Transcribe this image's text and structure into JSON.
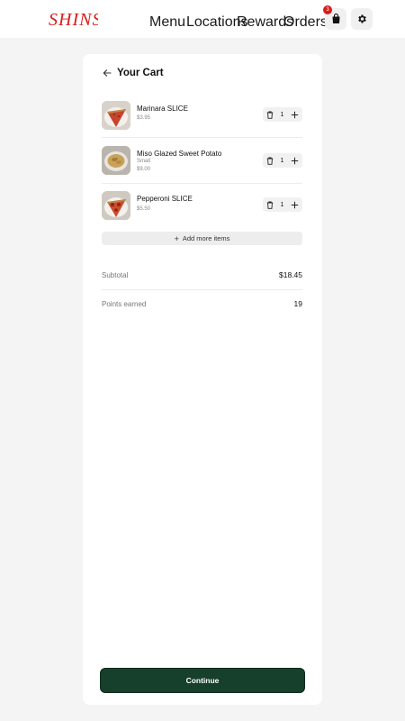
{
  "header": {
    "brand": "SHINS",
    "nav": [
      "Menu",
      "Locations",
      "Rewards",
      "Orders"
    ],
    "cart_badge": "3",
    "cart_icon": "shopping-bag-icon",
    "settings_icon": "gear-icon",
    "brand_color": "#d91a1a"
  },
  "cart": {
    "title": "Your Cart",
    "back_icon": "arrow-left-icon",
    "items": [
      {
        "name": "Marinara SLICE",
        "option": "",
        "price": "$3.95",
        "qty": "1"
      },
      {
        "name": "Miso Glazed Sweet Potato",
        "option": "Small",
        "price": "$9.00",
        "qty": "1"
      },
      {
        "name": "Pepperoni SLICE",
        "option": "",
        "price": "$5.50",
        "qty": "1"
      }
    ],
    "add_more_label": "Add more items",
    "subtotal_label": "Subtotal",
    "subtotal_value": "$18.45",
    "points_label": "Points earned",
    "points_value": "19",
    "continue_label": "Continue",
    "accent": "#163f2c"
  }
}
